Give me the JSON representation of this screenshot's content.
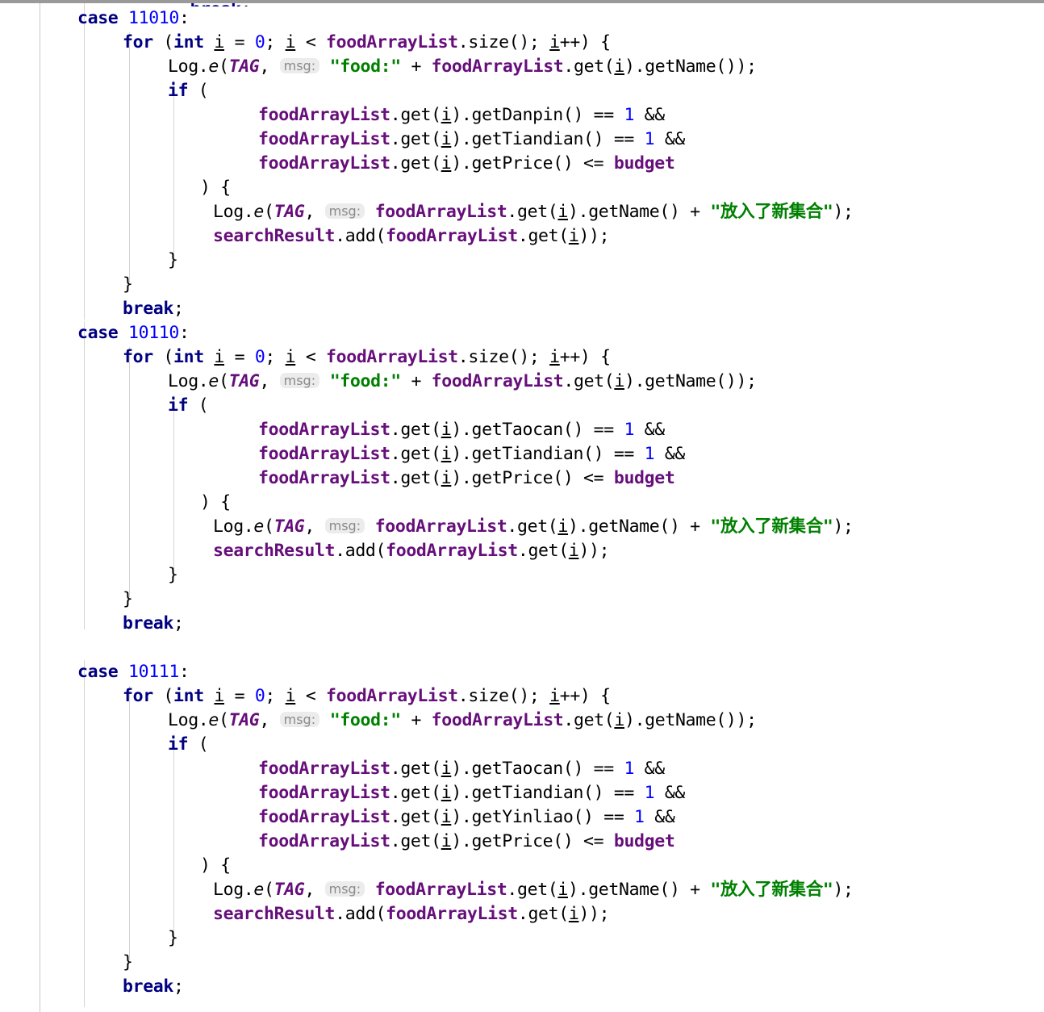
{
  "editor": {
    "language": "java",
    "colors": {
      "background": "#ffffff",
      "keyword": "#000080",
      "number": "#0000ff",
      "field": "#660e7a",
      "string": "#008000",
      "plain": "#000000",
      "indent_guide": "#d4d4d4",
      "gutter_rule": "#c9c9c9",
      "hint_background": "#ececec",
      "hint_text": "#8a8a8a"
    },
    "hint_label": "msg:",
    "strings": {
      "food_prefix": "\"food:\"",
      "added_to_set": "\"放入了新集合\""
    },
    "identifiers": {
      "list": "foodArrayList",
      "result": "searchResult",
      "tag": "TAG",
      "budget": "budget",
      "loop_var": "i",
      "logger": "Log",
      "log_method": "e"
    },
    "case_labels": [
      "11010",
      "10110",
      "10111"
    ],
    "getters": {
      "danpin": "getDanpin",
      "taocan": "getTaocan",
      "tiandian": "getTiandian",
      "yinliao": "getYinliao",
      "price": "getPrice",
      "name": "getName",
      "size": "size",
      "get": "get",
      "add": "add"
    },
    "blocks": [
      {
        "case": "11010",
        "conditions": [
          "getDanpin",
          "getTiandian",
          "getPrice"
        ],
        "comparisons": [
          "== 1 &&",
          "== 1 &&",
          "<= budget"
        ]
      },
      {
        "case": "10110",
        "conditions": [
          "getTaocan",
          "getTiandian",
          "getPrice"
        ],
        "comparisons": [
          "== 1 &&",
          "== 1 &&",
          "<= budget"
        ]
      },
      {
        "case": "10111",
        "conditions": [
          "getTaocan",
          "getTiandian",
          "getYinliao",
          "getPrice"
        ],
        "comparisons": [
          "== 1 &&",
          "== 1 &&",
          "== 1 &&",
          "<= budget"
        ]
      }
    ],
    "lines": [
      {
        "id": "l0",
        "kind": "partial-clipped"
      },
      {
        "id": "l1",
        "text": "case 11010:"
      },
      {
        "id": "l2",
        "text": "for (int i = 0; i < foodArrayList.size(); i++) {"
      },
      {
        "id": "l3",
        "text": "Log.e(TAG,  msg: \"food:\" + foodArrayList.get(i).getName());"
      },
      {
        "id": "l4",
        "text": "if ("
      },
      {
        "id": "l5",
        "text": "foodArrayList.get(i).getDanpin() == 1 &&"
      },
      {
        "id": "l6",
        "text": "foodArrayList.get(i).getTiandian() == 1 &&"
      },
      {
        "id": "l7",
        "text": "foodArrayList.get(i).getPrice() <= budget"
      },
      {
        "id": "l8",
        "text": ") {"
      },
      {
        "id": "l9",
        "text": "Log.e(TAG,  msg: foodArrayList.get(i).getName() + \"放入了新集合\");"
      },
      {
        "id": "l10",
        "text": "searchResult.add(foodArrayList.get(i));"
      },
      {
        "id": "l11",
        "text": "}"
      },
      {
        "id": "l12",
        "text": "}"
      },
      {
        "id": "l13",
        "text": "break;"
      },
      {
        "id": "l14",
        "text": "case 10110:"
      },
      {
        "id": "l15",
        "text": "for (int i = 0; i < foodArrayList.size(); i++) {"
      },
      {
        "id": "l16",
        "text": "Log.e(TAG,  msg: \"food:\" + foodArrayList.get(i).getName());"
      },
      {
        "id": "l17",
        "text": "if ("
      },
      {
        "id": "l18",
        "text": "foodArrayList.get(i).getTaocan() == 1 &&"
      },
      {
        "id": "l19",
        "text": "foodArrayList.get(i).getTiandian() == 1 &&"
      },
      {
        "id": "l20",
        "text": "foodArrayList.get(i).getPrice() <= budget"
      },
      {
        "id": "l21",
        "text": ") {"
      },
      {
        "id": "l22",
        "text": "Log.e(TAG,  msg: foodArrayList.get(i).getName() + \"放入了新集合\");"
      },
      {
        "id": "l23",
        "text": "searchResult.add(foodArrayList.get(i));"
      },
      {
        "id": "l24",
        "text": "}"
      },
      {
        "id": "l25",
        "text": "}"
      },
      {
        "id": "l26",
        "text": "break;"
      },
      {
        "id": "l27",
        "text": ""
      },
      {
        "id": "l28",
        "text": "case 10111:"
      },
      {
        "id": "l29",
        "text": "for (int i = 0; i < foodArrayList.size(); i++) {"
      },
      {
        "id": "l30",
        "text": "Log.e(TAG,  msg: \"food:\" + foodArrayList.get(i).getName());"
      },
      {
        "id": "l31",
        "text": "if ("
      },
      {
        "id": "l32",
        "text": "foodArrayList.get(i).getTaocan() == 1 &&"
      },
      {
        "id": "l33",
        "text": "foodArrayList.get(i).getTiandian() == 1 &&"
      },
      {
        "id": "l34",
        "text": "foodArrayList.get(i).getYinliao() == 1 &&"
      },
      {
        "id": "l35",
        "text": "foodArrayList.get(i).getPrice() <= budget"
      },
      {
        "id": "l36",
        "text": ") {"
      },
      {
        "id": "l37",
        "text": "Log.e(TAG,  msg: foodArrayList.get(i).getName() + \"放入了新集合\");"
      },
      {
        "id": "l38",
        "text": "searchResult.add(foodArrayList.get(i));"
      },
      {
        "id": "l39",
        "text": "}"
      },
      {
        "id": "l40",
        "text": "}"
      },
      {
        "id": "l41",
        "text": "break;"
      }
    ]
  }
}
